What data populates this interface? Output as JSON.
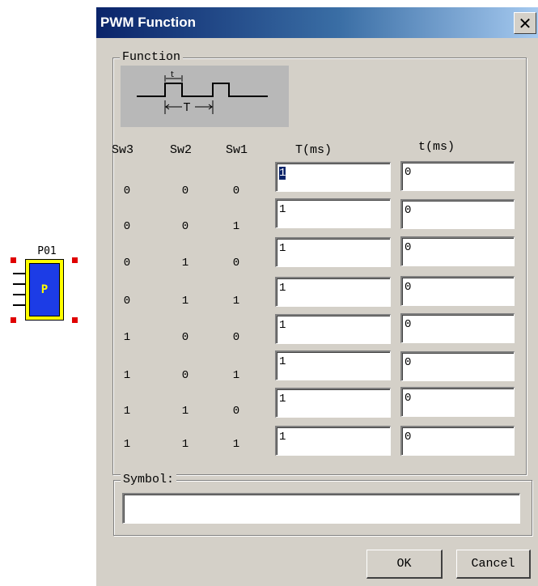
{
  "component": {
    "label": "P01",
    "letter": "P",
    "handle_color": "#e00000",
    "body_color": "#ffff00",
    "inner_color": "#1c3ce6"
  },
  "dialog": {
    "title": "PWM Function",
    "close_glyph": "✕",
    "function_group": {
      "title": "Function",
      "diagram": {
        "t_label": "t",
        "T_label": "T"
      }
    },
    "table": {
      "headers": {
        "sw3": "Sw3",
        "sw2": "Sw2",
        "sw1": "Sw1",
        "T": "T(ms)",
        "t": "t(ms)"
      },
      "rows": [
        {
          "sw3": "0",
          "sw2": "0",
          "sw1": "0",
          "T": "1",
          "t": "0"
        },
        {
          "sw3": "0",
          "sw2": "0",
          "sw1": "1",
          "T": "1",
          "t": "0"
        },
        {
          "sw3": "0",
          "sw2": "1",
          "sw1": "0",
          "T": "1",
          "t": "0"
        },
        {
          "sw3": "0",
          "sw2": "1",
          "sw1": "1",
          "T": "1",
          "t": "0"
        },
        {
          "sw3": "1",
          "sw2": "0",
          "sw1": "0",
          "T": "1",
          "t": "0"
        },
        {
          "sw3": "1",
          "sw2": "0",
          "sw1": "1",
          "T": "1",
          "t": "0"
        },
        {
          "sw3": "1",
          "sw2": "1",
          "sw1": "0",
          "T": "1",
          "t": "0"
        },
        {
          "sw3": "1",
          "sw2": "1",
          "sw1": "1",
          "T": "1",
          "t": "0"
        }
      ]
    },
    "symbol_group": {
      "title": "Symbol:",
      "value": ""
    },
    "buttons": {
      "ok": "OK",
      "cancel": "Cancel"
    }
  },
  "colors": {
    "dialog_bg": "#d4d0c8",
    "titlebar_start": "#0a246a",
    "titlebar_end": "#a6caf0",
    "selection": "#0a246a"
  }
}
